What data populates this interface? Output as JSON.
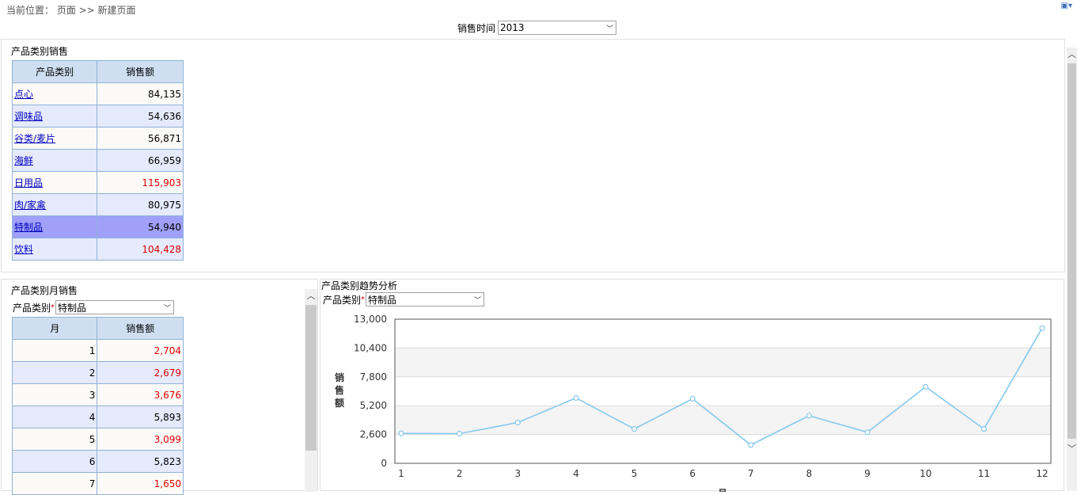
{
  "breadcrumb": "当前位置： 页面 >> 新建页面",
  "top_icons": "▣▾",
  "filter": {
    "label": "销售时间",
    "value": "2013"
  },
  "panel1": {
    "title": "产品类别销售",
    "headers": [
      "产品类别",
      "销售额"
    ],
    "rows": [
      {
        "name": "点心",
        "value": "84,135"
      },
      {
        "name": "调味品",
        "value": "54,636"
      },
      {
        "name": "谷类/麦片",
        "value": "56,871"
      },
      {
        "name": "海鲜",
        "value": "66,959"
      },
      {
        "name": "日用品",
        "value": "115,903"
      },
      {
        "name": "肉/家禽",
        "value": "80,975"
      },
      {
        "name": "特制品",
        "value": "54,940"
      },
      {
        "name": "饮料",
        "value": "104,428"
      }
    ]
  },
  "panel2": {
    "title": "产品类别月销售",
    "filter_label": "产品类别",
    "filter_value": "特制品",
    "headers": [
      "月",
      "销售额"
    ],
    "rows": [
      {
        "month": "1",
        "value": "2,704"
      },
      {
        "month": "2",
        "value": "2,679"
      },
      {
        "month": "3",
        "value": "3,676"
      },
      {
        "month": "4",
        "value": "5,893"
      },
      {
        "month": "5",
        "value": "3,099"
      },
      {
        "month": "6",
        "value": "5,823"
      },
      {
        "month": "7",
        "value": "1,650"
      }
    ]
  },
  "panel3": {
    "title": "产品类别趋势分析",
    "filter_label": "产品类别",
    "filter_value": "特制品"
  },
  "colors": {
    "line": "#86c9ec",
    "red": "#e00000",
    "link": "#0000c0"
  },
  "chart_data": {
    "type": "line",
    "x": [
      1,
      2,
      3,
      4,
      5,
      6,
      7,
      8,
      9,
      10,
      11,
      12
    ],
    "categories": [
      "1",
      "2",
      "3",
      "4",
      "5",
      "6",
      "7",
      "8",
      "9",
      "10",
      "11",
      "12"
    ],
    "series": [
      {
        "values": [
          2704,
          2679,
          3676,
          5893,
          3099,
          5823,
          1650,
          4300,
          2800,
          6900,
          3100,
          12200
        ]
      }
    ],
    "ylabel": "销售额",
    "xlabel": "月",
    "ylim": [
      0,
      13000
    ],
    "yticks": [
      0,
      2600,
      5200,
      7800,
      10400,
      13000
    ],
    "ytick_labels": [
      "0",
      "2,600",
      "5,200",
      "7,800",
      "10,400",
      "13,000"
    ],
    "grid": true,
    "legend": "none"
  }
}
